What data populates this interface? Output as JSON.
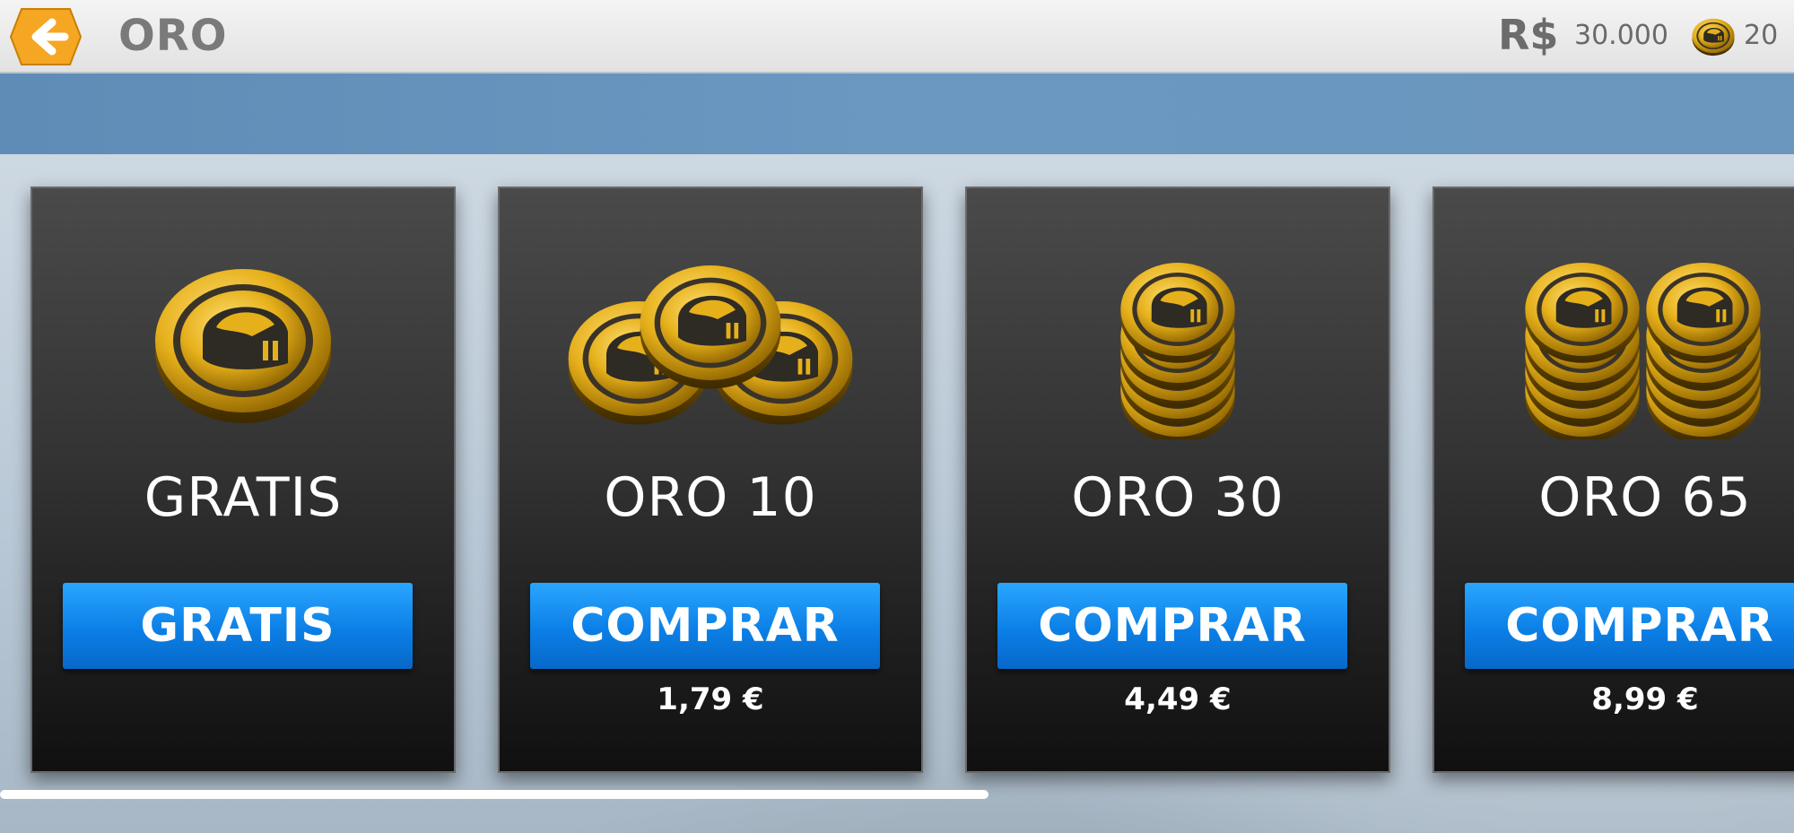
{
  "header": {
    "title": "ORO",
    "currency_symbol": "R$",
    "cash_amount": "30.000",
    "gold_amount": "20"
  },
  "colors": {
    "button_blue": "#0b7fe6",
    "gold": "#e4b11c",
    "back_orange": "#f5a623"
  },
  "cards": [
    {
      "title": "GRATIS",
      "button_label": "GRATIS",
      "price": "",
      "icon": "single-coin-icon"
    },
    {
      "title": "ORO 10",
      "button_label": "COMPRAR",
      "price": "1,79 €",
      "icon": "three-coins-icon"
    },
    {
      "title": "ORO 30",
      "button_label": "COMPRAR",
      "price": "4,49 €",
      "icon": "coin-stack-icon"
    },
    {
      "title": "ORO 65",
      "button_label": "COMPRAR",
      "price": "8,99 €",
      "icon": "two-coin-stacks-icon"
    }
  ]
}
